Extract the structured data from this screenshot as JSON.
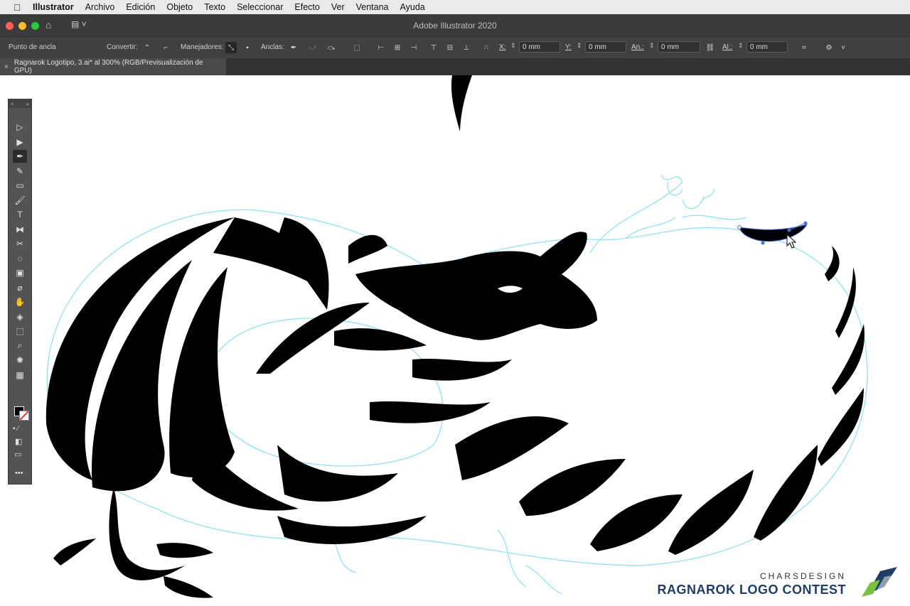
{
  "menubar": {
    "apple_icon": "apple-icon",
    "items": [
      "Illustrator",
      "Archivo",
      "Edición",
      "Objeto",
      "Texto",
      "Seleccionar",
      "Efecto",
      "Ver",
      "Ventana",
      "Ayuda"
    ]
  },
  "window": {
    "title": "Adobe Illustrator 2020",
    "traffic_colors": [
      "#ff5f57",
      "#febc2e",
      "#28c840"
    ]
  },
  "control_bar": {
    "selection_label": "Punto de ancla",
    "convert_label": "Convertir:",
    "handles_label": "Manejadores:",
    "anchors_label": "Anclas:",
    "x_label": "X:",
    "x_value": "0 mm",
    "y_label": "Y:",
    "y_value": "0 mm",
    "w_label": "An.:",
    "w_value": "0 mm",
    "h_label": "Al.:",
    "h_value": "0 mm"
  },
  "document_tab": {
    "title": "Ragnarok Logotipo, 3.ai* al 300% (RGB/Previsualización de GPU)"
  },
  "tools": [
    {
      "name": "selection-tool",
      "glyph": "▷"
    },
    {
      "name": "direct-selection-tool",
      "glyph": "▶"
    },
    {
      "name": "pen-tool",
      "glyph": "✒"
    },
    {
      "name": "curvature-tool",
      "glyph": "✎"
    },
    {
      "name": "rectangle-tool",
      "glyph": "▭"
    },
    {
      "name": "paintbrush-tool",
      "glyph": "🖌"
    },
    {
      "name": "type-tool",
      "glyph": "T"
    },
    {
      "name": "reflect-tool",
      "glyph": "⧓"
    },
    {
      "name": "scissors-tool",
      "glyph": "✂"
    },
    {
      "name": "lasso-tool",
      "glyph": "◌"
    },
    {
      "name": "gradient-tool",
      "glyph": "▣"
    },
    {
      "name": "eyedropper-tool",
      "glyph": "⌀"
    },
    {
      "name": "puppet-warp-tool",
      "glyph": "✋"
    },
    {
      "name": "shape-builder-tool",
      "glyph": "◈"
    },
    {
      "name": "artboard-tool",
      "glyph": "⬚"
    },
    {
      "name": "zoom-tool",
      "glyph": "⌕"
    },
    {
      "name": "symbol-sprayer-tool",
      "glyph": "✺"
    },
    {
      "name": "graph-tool",
      "glyph": "▦"
    }
  ],
  "colors": {
    "fill": "#000000",
    "outline": "#8fe3f0",
    "accent": "#1f3e66"
  },
  "branding": {
    "top_text": "CHARSDESIGN",
    "main_text": "RAGNAROK LOGO CONTEST"
  }
}
